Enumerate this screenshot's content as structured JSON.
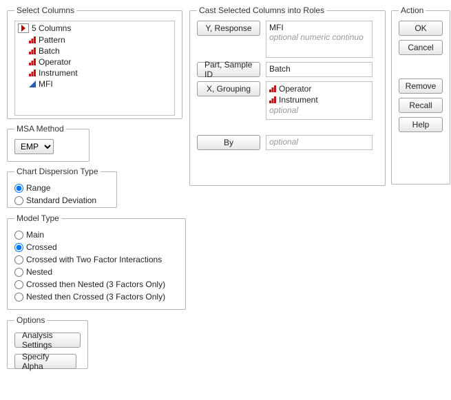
{
  "select_columns": {
    "legend": "Select Columns",
    "count_label": "5 Columns",
    "items": [
      {
        "label": "Pattern",
        "type": "nominal"
      },
      {
        "label": "Batch",
        "type": "nominal"
      },
      {
        "label": "Operator",
        "type": "nominal"
      },
      {
        "label": "Instrument",
        "type": "nominal"
      },
      {
        "label": "MFI",
        "type": "continuous"
      }
    ]
  },
  "msa_method": {
    "legend": "MSA Method",
    "value": "EMP"
  },
  "dispersion": {
    "legend": "Chart Dispersion Type",
    "options": [
      {
        "label": "Range",
        "checked": true
      },
      {
        "label": "Standard Deviation",
        "checked": false
      }
    ]
  },
  "model_type": {
    "legend": "Model Type",
    "options": [
      {
        "label": "Main",
        "checked": false
      },
      {
        "label": "Crossed",
        "checked": true
      },
      {
        "label": "Crossed with Two Factor Interactions",
        "checked": false
      },
      {
        "label": "Nested",
        "checked": false
      },
      {
        "label": "Crossed then Nested (3 Factors Only)",
        "checked": false
      },
      {
        "label": "Nested then Crossed (3 Factors Only)",
        "checked": false
      }
    ]
  },
  "options": {
    "legend": "Options",
    "analysis_settings": "Analysis Settings",
    "specify_alpha": "Specify Alpha"
  },
  "cast": {
    "legend": "Cast Selected Columns into Roles",
    "y_button": "Y, Response",
    "y_value": "MFI",
    "y_hint": "optional numeric continuo",
    "part_button": "Part, Sample ID",
    "part_value": "Batch",
    "x_button": "X, Grouping",
    "x_items": [
      {
        "label": "Operator",
        "type": "nominal"
      },
      {
        "label": "Instrument",
        "type": "nominal"
      }
    ],
    "x_hint": "optional",
    "by_button": "By",
    "by_hint": "optional"
  },
  "action": {
    "legend": "Action",
    "ok": "OK",
    "cancel": "Cancel",
    "remove": "Remove",
    "recall": "Recall",
    "help": "Help"
  }
}
